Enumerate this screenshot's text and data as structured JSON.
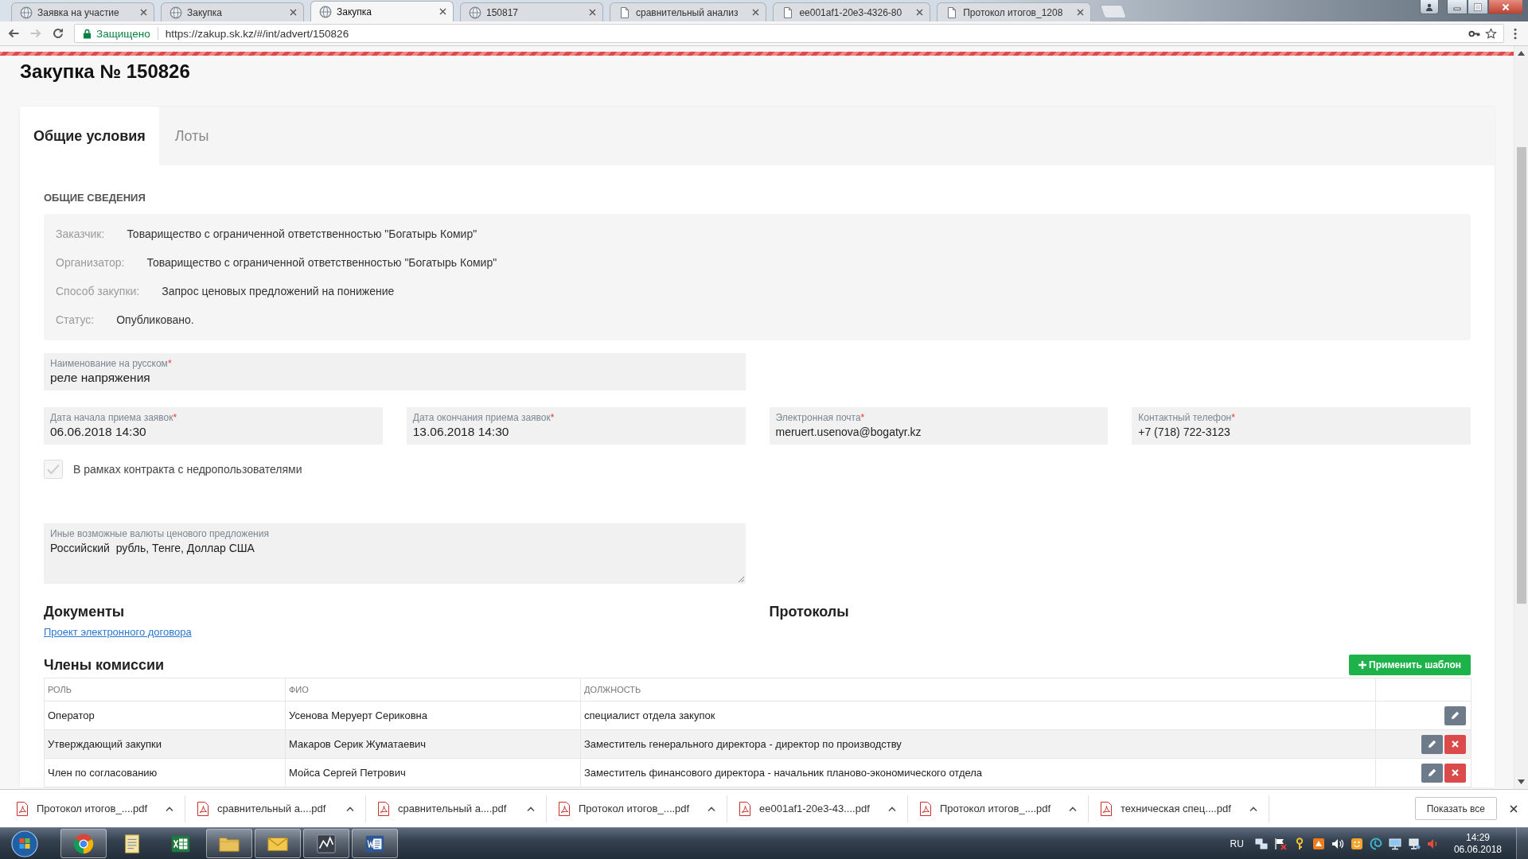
{
  "browser": {
    "tabs": [
      {
        "kind": "site",
        "title": "Заявка на участие",
        "selected": false
      },
      {
        "kind": "site",
        "title": "Закупка",
        "selected": false
      },
      {
        "kind": "site",
        "title": "Закупка",
        "selected": true
      },
      {
        "kind": "site",
        "title": "150817",
        "selected": false
      },
      {
        "kind": "file",
        "title": "сравнительный анализ",
        "selected": false
      },
      {
        "kind": "file",
        "title": "ee001af1-20e3-4326-80",
        "selected": false
      },
      {
        "kind": "file",
        "title": "Протокол итогов_1208",
        "selected": false
      }
    ],
    "address": {
      "security": "Защищено",
      "url": "https://zakup.sk.kz/#/int/advert/150826"
    }
  },
  "page": {
    "title": "Закупка № 150826",
    "tabs": [
      {
        "label": "Общие условия",
        "selected": true
      },
      {
        "label": "Лоты",
        "selected": false
      }
    ],
    "general": {
      "heading": "ОБЩИЕ СВЕДЕНИЯ",
      "rows": [
        {
          "label": "Заказчик:",
          "value": "Товарищество с ограниченной ответственностью \"Богатырь Комир\""
        },
        {
          "label": "Организатор:",
          "value": "Товарищество с ограниченной ответственностью \"Богатырь Комир\""
        },
        {
          "label": "Способ закупки:",
          "value": "Запрос ценовых предложений на понижение"
        },
        {
          "label": "Статус:",
          "value": "Опубликовано."
        }
      ]
    },
    "name_field": {
      "label": "Наименование на русском",
      "required_mark": "*",
      "value": "реле напряжения"
    },
    "fields": [
      {
        "label": "Дата начала приема заявок",
        "required_mark": "*",
        "value": "06.06.2018 14:30"
      },
      {
        "label": "Дата окончания приема заявок",
        "required_mark": "*",
        "value": "13.06.2018 14:30"
      },
      {
        "label": "Электронная почта",
        "required_mark": "*",
        "value": "meruert.usenova@bogatyr.kz"
      },
      {
        "label": "Контактный телефон",
        "required_mark": "*",
        "value": "+7 (718) 722-3123"
      }
    ],
    "subsoil_contract": {
      "label": "В рамках контракта с недропользователями",
      "checked": true,
      "disabled": true
    },
    "currencies": {
      "label": "Иные возможные валюты ценового предложения",
      "value": "Российский  рубль, Тенге, Доллар США"
    },
    "documents": {
      "heading": "Документы",
      "links": [
        "Проект электронного договора"
      ]
    },
    "protocols": {
      "heading": "Протоколы"
    },
    "commission": {
      "heading": "Члены комиссии",
      "apply_button": "Применить шаблон",
      "columns": [
        "РОЛЬ",
        "ФИО",
        "ДОЛЖНОСТЬ"
      ],
      "rows": [
        {
          "role": "Оператор",
          "name": "Усенова Меруерт Сериковна",
          "position": "специалист отдела закупок",
          "actions": [
            {
              "kind": "edit"
            }
          ]
        },
        {
          "role": "Утверждающий закупки",
          "name": "Макаров Серик Жуматаевич",
          "position": "Заместитель генерального директора - директор по производству",
          "actions": [
            {
              "kind": "edit"
            },
            {
              "kind": "delete"
            }
          ]
        },
        {
          "role": "Член по согласованию",
          "name": "Мойса Сергей Петрович",
          "position": "Заместитель финансового директора - начальник планово-экономического отдела",
          "actions": [
            {
              "kind": "edit"
            },
            {
              "kind": "delete"
            }
          ]
        }
      ]
    }
  },
  "downloads": {
    "items": [
      "Протокол итогов_....pdf",
      "сравнительный а....pdf",
      "сравнительный а....pdf",
      "Протокол итогов_....pdf",
      "ee001af1-20e3-43....pdf",
      "Протокол итогов_....pdf",
      "техническая спец....pdf"
    ],
    "show_all": "Показать все"
  },
  "taskbar": {
    "apps": [
      {
        "kind": "browser",
        "running": true
      },
      {
        "kind": "notes",
        "running": false
      },
      {
        "kind": "spreadsheet",
        "running": false
      },
      {
        "kind": "folder",
        "running": true
      },
      {
        "kind": "mail",
        "running": true
      },
      {
        "kind": "graph",
        "running": true
      },
      {
        "kind": "word",
        "running": true
      }
    ],
    "tray": {
      "language": "RU",
      "time": "14:29",
      "date": "06.06.2018"
    }
  }
}
